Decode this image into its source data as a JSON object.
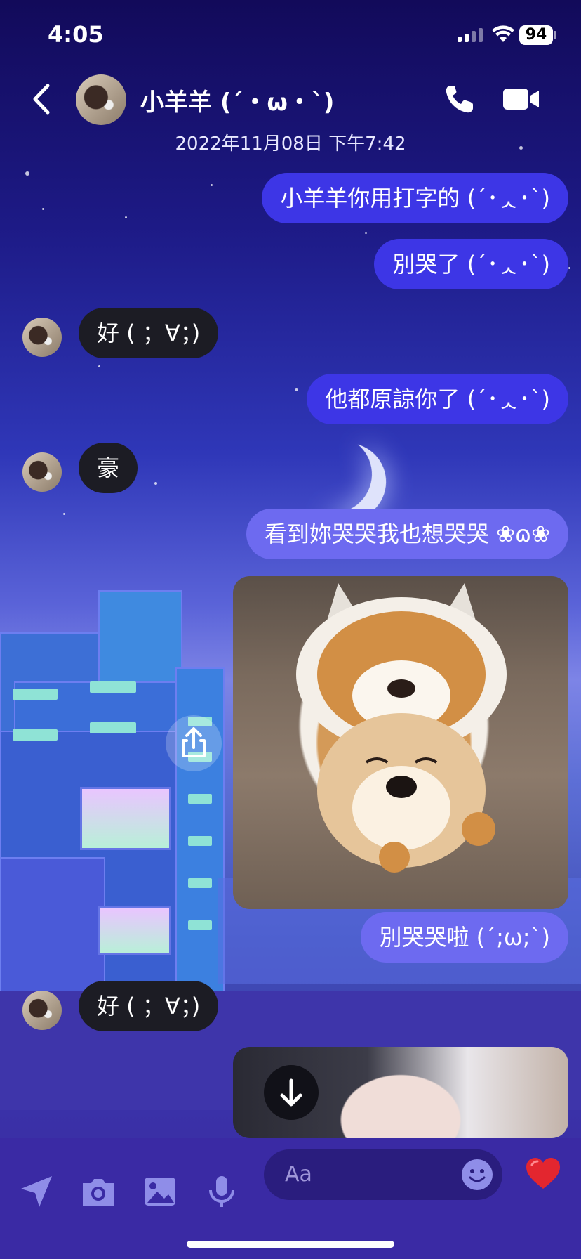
{
  "status_bar": {
    "time": "4:05",
    "battery": "94"
  },
  "header": {
    "contact_name": "小羊羊 (´・ω・`)"
  },
  "timestamp": "2022年11月08日 下午7:42",
  "messages": [
    {
      "side": "out",
      "text": "小羊羊你用打字的 (´･ᆺ･`)"
    },
    {
      "side": "out",
      "text": "別哭了 (´･ᆺ･`)"
    },
    {
      "side": "in",
      "text": "好 ( ；∀；)"
    },
    {
      "side": "out",
      "text": "他都原諒你了 (´･ᆺ･`)"
    },
    {
      "side": "in",
      "text": "豪"
    },
    {
      "side": "out",
      "text": "看到妳哭哭我也想哭哭 ❀ɷ❀"
    },
    {
      "side": "out",
      "text": "別哭哭啦 (´;ω;`)"
    },
    {
      "side": "in",
      "text": "好 ( ；∀；)"
    }
  ],
  "composer": {
    "placeholder": "Aa"
  },
  "icons": {
    "back": "chevron-left-icon",
    "call": "phone-icon",
    "video": "video-camera-icon",
    "share": "share-icon",
    "scroll_down": "arrow-down-icon",
    "location": "location-arrow-icon",
    "camera": "camera-icon",
    "gallery": "image-icon",
    "mic": "microphone-icon",
    "emoji": "smiley-icon",
    "heart": "heart-icon"
  },
  "colors": {
    "outgoing_bubble": "#3d36e6",
    "incoming_bubble": "#1c1c24",
    "composer_bg": "#3a2aa4",
    "heart": "#e3262f"
  }
}
